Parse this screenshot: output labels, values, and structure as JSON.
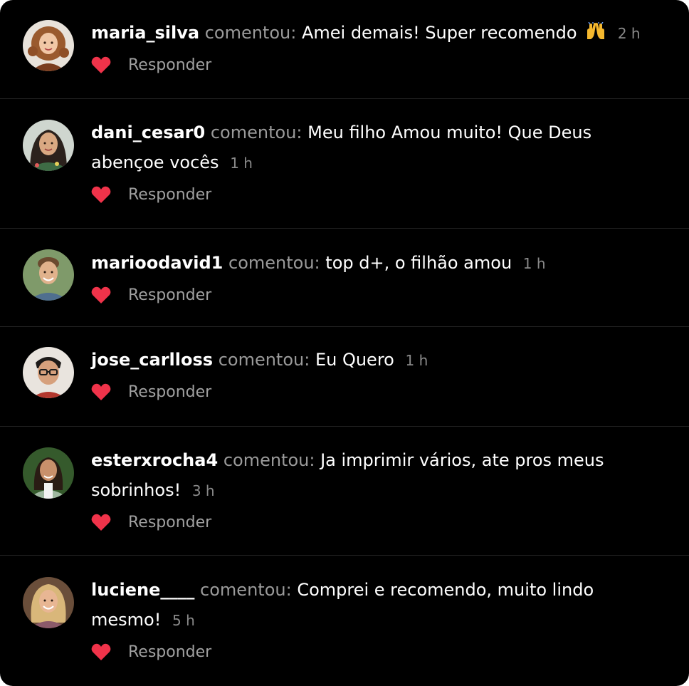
{
  "colors": {
    "background": "#000000",
    "divider": "#222222",
    "username": "#ffffff",
    "verb": "#9a9a9a",
    "message": "#ffffff",
    "time": "#8a8a8a",
    "heart": "#f0334a",
    "reply": "#a0a0a0"
  },
  "comments": [
    {
      "username": "maria_silva",
      "verb": "comentou:",
      "message": "Amei demais! Super recomendo",
      "emoji": "raising-hands-icon",
      "time": "2 h",
      "reply_label": "Responder",
      "avatar": "avatar-woman-curly-hair"
    },
    {
      "username": "dani_cesar0",
      "verb": "comentou:",
      "message": "Meu filho Amou muito! Que Deus abençoe vocês",
      "time": "1 h",
      "reply_label": "Responder",
      "avatar": "avatar-woman-dark-hair"
    },
    {
      "username": "marioodavid1",
      "verb": "comentou:",
      "message": "top d+, o filhão amou",
      "time": "1 h",
      "reply_label": "Responder",
      "avatar": "avatar-man-smiling"
    },
    {
      "username": "jose_carlloss",
      "verb": "comentou:",
      "message": "Eu Quero",
      "time": "1 h",
      "reply_label": "Responder",
      "avatar": "avatar-man-glasses"
    },
    {
      "username": "esterxrocha4",
      "verb": "comentou:",
      "message": "Ja imprimir vários, ate  pros meus sobrinhos!",
      "time": "3 h",
      "reply_label": "Responder",
      "avatar": "avatar-woman-green-jacket"
    },
    {
      "username": "luciene____",
      "verb": "comentou:",
      "message": "Comprei e recomendo, muito lindo mesmo!",
      "time": "5 h",
      "reply_label": "Responder",
      "avatar": "avatar-woman-blonde"
    }
  ]
}
